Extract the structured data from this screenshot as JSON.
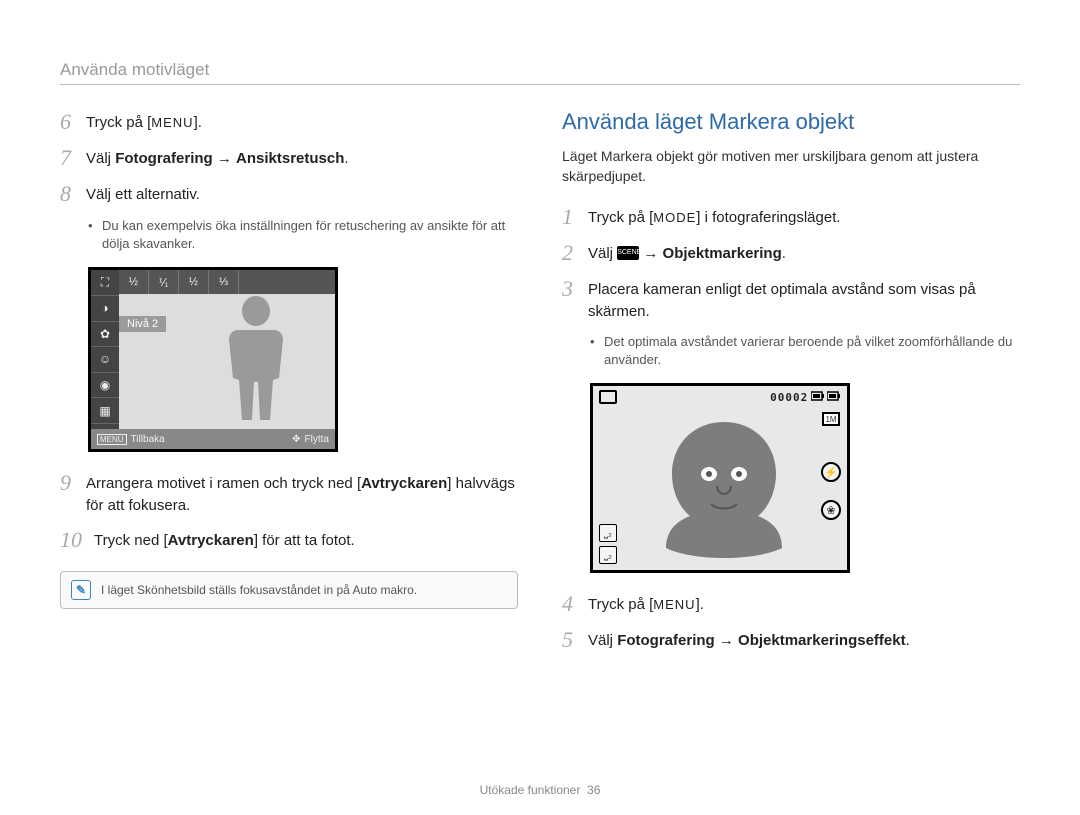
{
  "header": {
    "title": "Använda motivläget"
  },
  "left": {
    "steps": {
      "6": {
        "num": "6",
        "pre": "Tryck på [",
        "btn": "MENU",
        "post": "]."
      },
      "7": {
        "num": "7",
        "pre": "Välj ",
        "bold1": "Fotografering",
        "arrow": " → ",
        "bold2": "Ansiktsretusch",
        "post": "."
      },
      "8": {
        "num": "8",
        "text": "Välj ett alternativ.",
        "bullet": "Du kan exempelvis öka inställningen för retuschering av ansikte för att dölja skavanker."
      },
      "9": {
        "num": "9",
        "pre": "Arrangera motivet i ramen och tryck ned [",
        "bold": "Avtryckaren",
        "post": "] halvvägs för att fokusera."
      },
      "10": {
        "num": "10",
        "pre": "Tryck ned [",
        "bold": "Avtryckaren",
        "post": "] för att ta fotot."
      }
    },
    "lcd": {
      "level_label": "Nivå 2",
      "back_menu": "MENU",
      "back_label": "Tillbaka",
      "move_label": "Flytta",
      "top_icons": [
        "⁠½",
        "⁠⅟₁",
        "⁠½",
        "⁠⅓"
      ]
    },
    "note": "I läget Skönhetsbild ställs fokusavståndet in på Auto makro."
  },
  "right": {
    "title": "Använda läget Markera objekt",
    "intro": "Läget Markera objekt gör motiven mer urskiljbara genom att justera skärpedjupet.",
    "steps": {
      "1": {
        "num": "1",
        "pre": "Tryck på [",
        "btn": "MODE",
        "post": "] i fotograferingsläget."
      },
      "2": {
        "num": "2",
        "pre": "Välj ",
        "scene": "SCENE",
        "arrow": " → ",
        "bold": "Objektmarkering",
        "post": "."
      },
      "3": {
        "num": "3",
        "text": "Placera kameran enligt det optimala avstånd som visas på skärmen.",
        "bullet": "Det optimala avståndet varierar beroende på vilket zoomförhållande du använder."
      },
      "4": {
        "num": "4",
        "pre": "Tryck på [",
        "btn": "MENU",
        "post": "]."
      },
      "5": {
        "num": "5",
        "pre": "Välj ",
        "bold1": "Fotografering",
        "arrow": " → ",
        "bold2": "Objektmarkeringseffekt",
        "post": "."
      }
    },
    "lcd": {
      "counter": "00002",
      "res": "1M"
    }
  },
  "footer": {
    "section": "Utökade funktioner",
    "page": "36"
  }
}
